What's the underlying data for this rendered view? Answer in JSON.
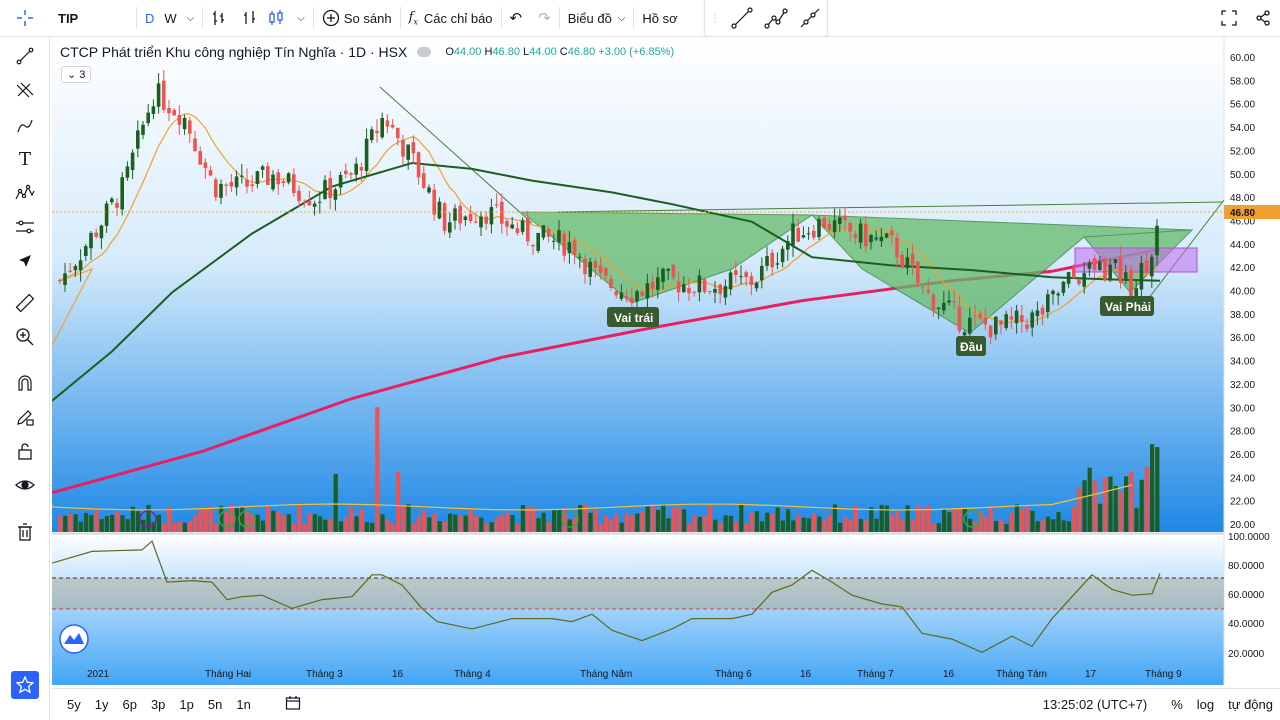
{
  "topbar": {
    "symbol": "TIP",
    "interval_d": "D",
    "interval_w": "W",
    "compare_label": "So sánh",
    "indicators_label": "Các chỉ báo",
    "chart_label": "Biểu đồ",
    "profile_label": "Hồ sơ"
  },
  "legend": {
    "title": "CTCP Phát triển Khu công nghiệp Tín Nghĩa · 1D · HSX",
    "ohlc_o_label": "O",
    "ohlc_o": "44.00",
    "ohlc_h_label": "H",
    "ohlc_h": "46.80",
    "ohlc_l_label": "L",
    "ohlc_l": "44.00",
    "ohlc_c_label": "C",
    "ohlc_c": "46.80",
    "change": "+3.00 (+6.85%)",
    "indicator_count": "3"
  },
  "price_axis": [
    "60.00",
    "58.00",
    "56.00",
    "54.00",
    "52.00",
    "50.00",
    "48.00",
    "46.00",
    "44.00",
    "42.00",
    "40.00",
    "38.00",
    "36.00",
    "34.00",
    "32.00",
    "30.00",
    "28.00",
    "26.00",
    "24.00",
    "22.00",
    "20.00"
  ],
  "last_price": "46.80",
  "rsi_axis": [
    "100.0000",
    "80.0000",
    "60.0000",
    "40.0000",
    "20.0000"
  ],
  "time_axis": [
    "2021",
    "Tháng Hai",
    "Tháng 3",
    "16",
    "Tháng 4",
    "Tháng Năm",
    "Tháng 6",
    "16",
    "Tháng 7",
    "16",
    "Tháng Tám",
    "17",
    "Tháng 9"
  ],
  "pattern_labels": {
    "left_shoulder": "Vai trái",
    "head": "Đầu",
    "right_shoulder": "Vai Phải"
  },
  "bottombar": {
    "ranges": [
      "5y",
      "1y",
      "6p",
      "3p",
      "1p",
      "5n",
      "1n"
    ],
    "clock": "13:25:02 (UTC+7)",
    "percent": "%",
    "log": "log",
    "auto": "tự động"
  },
  "colors": {
    "up": "#1b5e20",
    "down": "#ef5350",
    "ma_fast": "#f0a030",
    "ma_mid": "#1b5e20",
    "ma_slow": "#e91e63",
    "pattern_fill": "#66bb6a",
    "accent": "#2962ff"
  },
  "chart_data": {
    "type": "candlestick",
    "price_range": [
      20,
      60
    ],
    "rsi_range": [
      20,
      100
    ],
    "last_close": 46.8
  }
}
